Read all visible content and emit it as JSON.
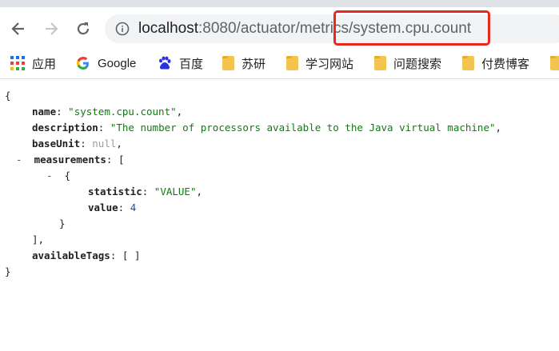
{
  "browser": {
    "url_host": "localhost",
    "url_port": ":8080",
    "url_path": "/actuator/metrics/system.cpu.count"
  },
  "bookmarks": [
    {
      "label": "应用",
      "icon": "apps-grid-icon"
    },
    {
      "label": "Google",
      "icon": "google-g-icon"
    },
    {
      "label": "百度",
      "icon": "baidu-paw-icon"
    },
    {
      "label": "苏研",
      "icon": "folder-icon"
    },
    {
      "label": "学习网站",
      "icon": "folder-icon"
    },
    {
      "label": "问题搜索",
      "icon": "folder-icon"
    },
    {
      "label": "付费博客",
      "icon": "folder-icon"
    }
  ],
  "json": {
    "open_brace": "{",
    "name_key": "name",
    "name_value": "\"system.cpu.count\"",
    "description_key": "description",
    "description_value": "\"The number of processors available to the Java virtual machine\"",
    "baseUnit_key": "baseUnit",
    "baseUnit_value": "null",
    "measurements_key": "measurements",
    "statistic_key": "statistic",
    "statistic_value": "\"VALUE\"",
    "value_key": "value",
    "value_value": "4",
    "availableTags_key": "availableTags",
    "availableTags_value": "[ ]",
    "close_brace": "}"
  },
  "colors": {
    "highlight_box": "#e8271f",
    "string": "#107c10",
    "number": "#1a48b3",
    "null": "#9e9e9e"
  }
}
